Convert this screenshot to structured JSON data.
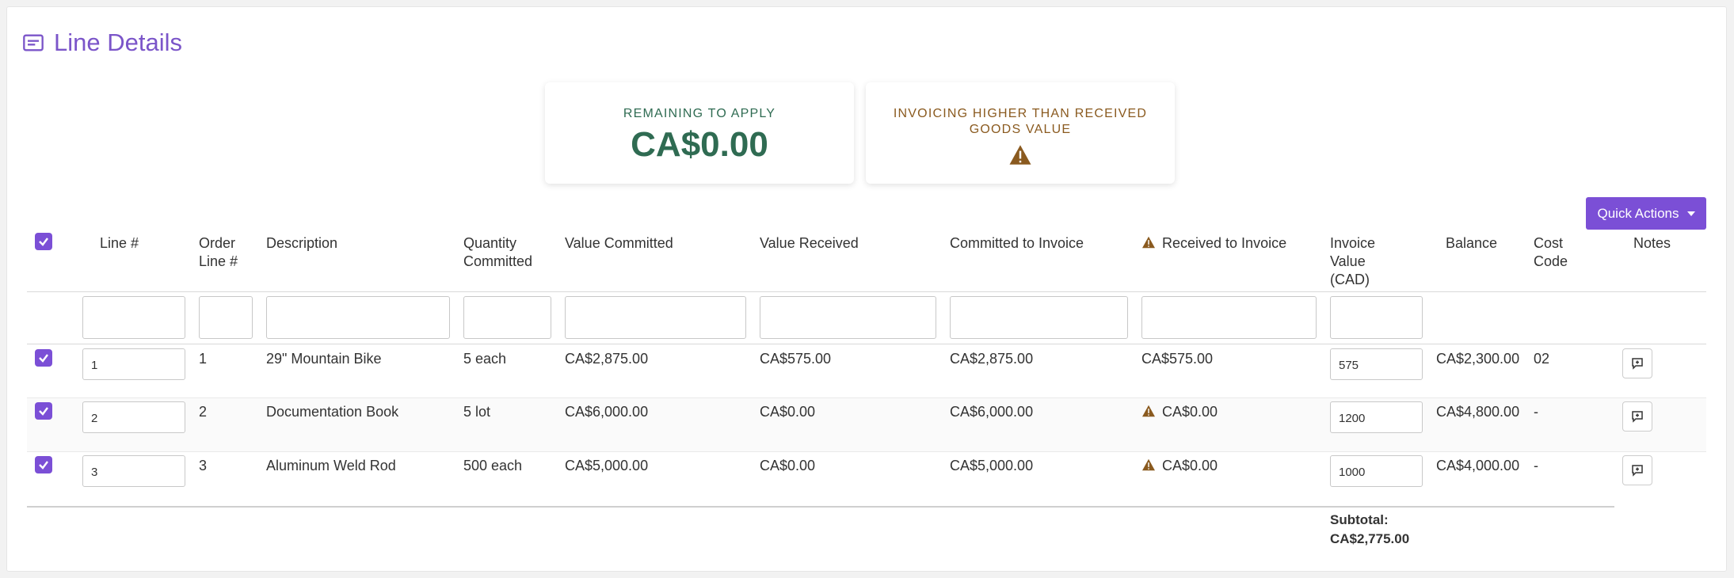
{
  "section": {
    "title": "Line Details",
    "icon": "list-card-icon"
  },
  "summary": {
    "remaining_label": "REMAINING TO APPLY",
    "remaining_value": "CA$0.00",
    "warning_label": "INVOICING HIGHER THAN RECEIVED GOODS VALUE",
    "warning_icon": "warning-icon"
  },
  "quick_actions": {
    "label": "Quick Actions"
  },
  "columns": {
    "line": "Line #",
    "order_line": "Order Line #",
    "description": "Description",
    "qty": "Quantity Committed",
    "value_committed": "Value Committed",
    "value_received": "Value Received",
    "committed_to_invoice": "Committed to Invoice",
    "received_to_invoice": "Received to Invoice",
    "invoice_value": "Invoice Value (CAD)",
    "balance": "Balance",
    "cost_code": "Cost Code",
    "notes": "Notes"
  },
  "rows": [
    {
      "checked": true,
      "line": "1",
      "order_line": "1",
      "description": "29\" Mountain Bike",
      "qty": "5 each",
      "value_committed": "CA$2,875.00",
      "value_received": "CA$575.00",
      "committed_to_invoice": "CA$2,875.00",
      "received_to_invoice": "CA$575.00",
      "received_warning": false,
      "invoice_value": "575",
      "balance": "CA$2,300.00",
      "cost_code": "02"
    },
    {
      "checked": true,
      "line": "2",
      "order_line": "2",
      "description": "Documentation Book",
      "qty": "5 lot",
      "value_committed": "CA$6,000.00",
      "value_received": "CA$0.00",
      "committed_to_invoice": "CA$6,000.00",
      "received_to_invoice": "CA$0.00",
      "received_warning": true,
      "invoice_value": "1200",
      "balance": "CA$4,800.00",
      "cost_code": "-"
    },
    {
      "checked": true,
      "line": "3",
      "order_line": "3",
      "description": "Aluminum Weld Rod",
      "qty": "500 each",
      "value_committed": "CA$5,000.00",
      "value_received": "CA$0.00",
      "committed_to_invoice": "CA$5,000.00",
      "received_to_invoice": "CA$0.00",
      "received_warning": true,
      "invoice_value": "1000",
      "balance": "CA$4,000.00",
      "cost_code": "-"
    }
  ],
  "footer": {
    "subtotal_label": "Subtotal:",
    "subtotal_value": "CA$2,775.00"
  },
  "colors": {
    "accent": "#7b4fd6",
    "success": "#2f6b52",
    "warning": "#8a5a1f"
  }
}
